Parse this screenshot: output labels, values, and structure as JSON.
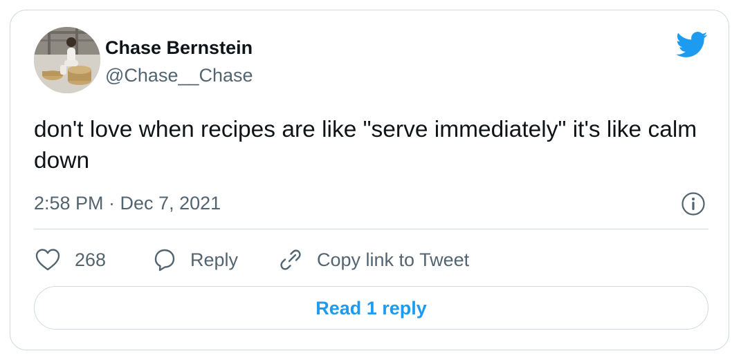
{
  "author": {
    "display_name": "Chase Bernstein",
    "handle": "@Chase__Chase"
  },
  "tweet": {
    "text": "don't love when recipes are like \"serve immediately\" it's like calm down",
    "timestamp": "2:58 PM · Dec 7, 2021"
  },
  "actions": {
    "like_count": "268",
    "reply_label": "Reply",
    "copy_link_label": "Copy link to Tweet"
  },
  "read_reply_label": "Read 1 reply",
  "icons": {
    "brand": "twitter-bird-icon",
    "info": "info-icon",
    "like": "heart-icon",
    "reply": "speech-bubble-icon",
    "copy_link": "link-icon"
  },
  "colors": {
    "accent": "#1d9bf0",
    "text_primary": "#0f1419",
    "text_secondary": "#536471",
    "border": "#cfd9de"
  }
}
